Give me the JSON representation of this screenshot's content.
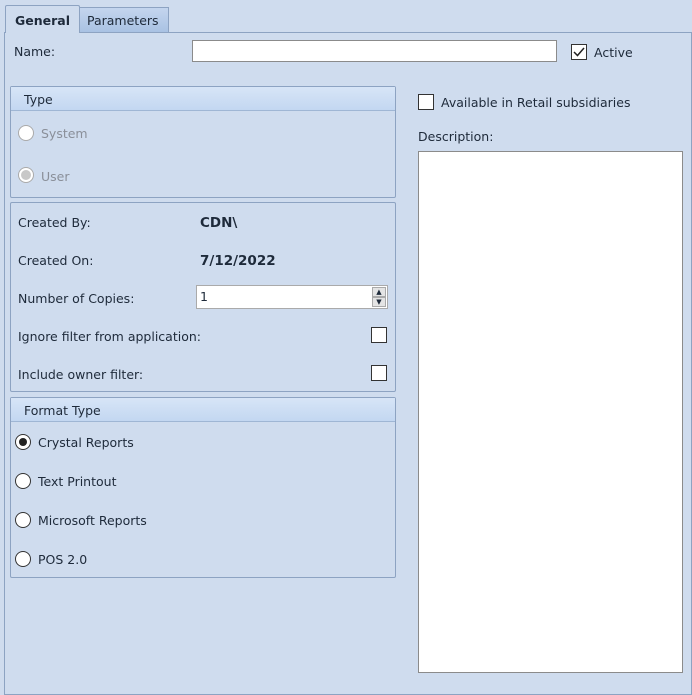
{
  "tabs": [
    {
      "label": "General",
      "active": true
    },
    {
      "label": "Parameters",
      "active": false
    }
  ],
  "name": {
    "label": "Name:",
    "value": ""
  },
  "active": {
    "label": "Active",
    "checked": true
  },
  "type": {
    "title": "Type",
    "options": [
      {
        "label": "System",
        "selected": false,
        "disabled": true
      },
      {
        "label": "User",
        "selected": true,
        "disabled": true
      }
    ]
  },
  "info": {
    "created_by_label": "Created By:",
    "created_by": "CDN\\",
    "created_on_label": "Created On:",
    "created_on": "7/12/2022",
    "copies_label": "Number of Copies:",
    "copies": "1",
    "ignore_filter_label": "Ignore filter from application:",
    "ignore_filter": false,
    "owner_filter_label": "Include owner filter:",
    "owner_filter": false
  },
  "format": {
    "title": "Format Type",
    "options": [
      {
        "label": "Crystal Reports",
        "selected": true
      },
      {
        "label": "Text Printout",
        "selected": false
      },
      {
        "label": "Microsoft Reports",
        "selected": false
      },
      {
        "label": "POS 2.0",
        "selected": false
      }
    ]
  },
  "retail": {
    "label": "Available in Retail subsidiaries",
    "checked": false
  },
  "description": {
    "label": "Description:",
    "value": ""
  }
}
